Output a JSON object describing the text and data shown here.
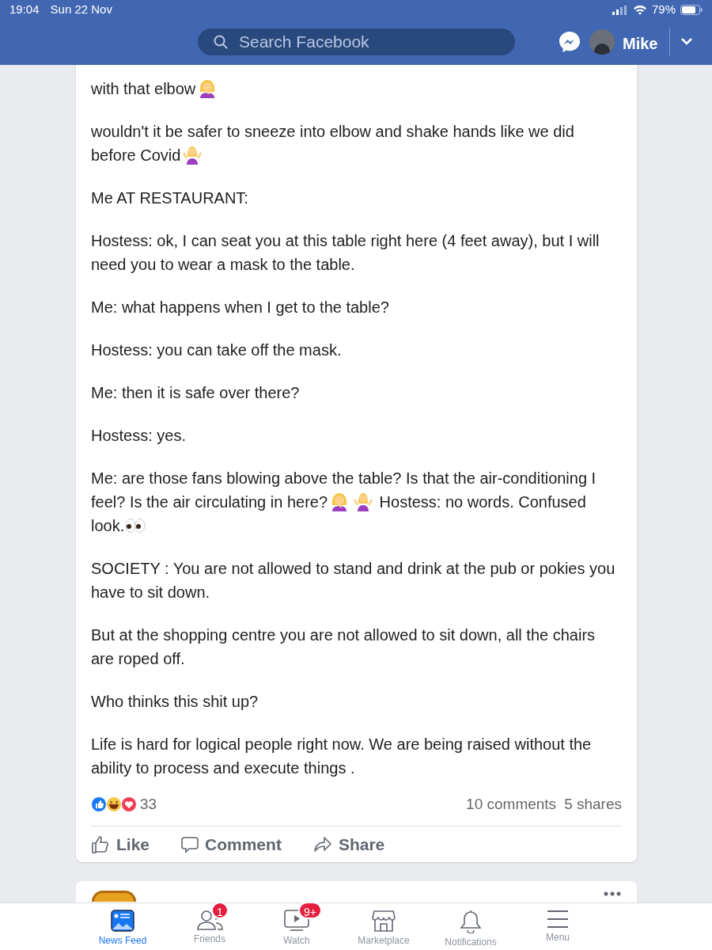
{
  "status_bar": {
    "time": "19:04",
    "date": "Sun 22 Nov",
    "battery": "79%"
  },
  "header": {
    "search": {
      "placeholder": "Search Facebook"
    },
    "user": "Mike"
  },
  "post": {
    "paragraphs": [
      [
        {
          "kind": "text",
          "text": "with that elbow"
        },
        {
          "kind": "facepalm"
        }
      ],
      [
        {
          "kind": "text",
          "text": "wouldn't it be safer to sneeze into elbow and shake hands like we did before Covid"
        },
        {
          "kind": "shrug"
        }
      ],
      [
        {
          "kind": "text",
          "text": "Me AT RESTAURANT:"
        }
      ],
      [
        {
          "kind": "text",
          "text": "Hostess: ok, I can seat you at this table right here (4 feet away), but I will need you to wear a mask to the table."
        }
      ],
      [
        {
          "kind": "text",
          "text": "Me: what happens when I get to the table?"
        }
      ],
      [
        {
          "kind": "text",
          "text": "Hostess: you can take off the mask."
        }
      ],
      [
        {
          "kind": "text",
          "text": "Me: then it is safe over there?"
        }
      ],
      [
        {
          "kind": "text",
          "text": "Hostess: yes."
        }
      ],
      [
        {
          "kind": "text",
          "text": "Me: are those fans blowing above the table? Is that the air-conditioning I feel? Is the air circulating in here?"
        },
        {
          "kind": "facepalm"
        },
        {
          "kind": "shrug"
        },
        {
          "kind": "text",
          "text": " Hostess: no words. Confused look."
        },
        {
          "kind": "eyes"
        }
      ],
      [
        {
          "kind": "text",
          "text": "SOCIETY : You are not allowed to stand and drink at the pub or pokies you have to sit down."
        }
      ],
      [
        {
          "kind": "text",
          "text": "But at the shopping centre you are not allowed to sit down, all the chairs are roped off."
        }
      ],
      [
        {
          "kind": "text",
          "text": "Who thinks this shit up?"
        }
      ],
      [
        {
          "kind": "text",
          "text": "Life is hard for logical people right now. We are being raised without the ability to process and execute things ."
        }
      ]
    ],
    "reaction_count": "33",
    "comments": "10 comments",
    "shares": "5 shares",
    "actions": [
      {
        "kind": "like",
        "label": "Like"
      },
      {
        "kind": "comment",
        "label": "Comment"
      },
      {
        "kind": "share",
        "label": "Share"
      }
    ]
  },
  "bottom_nav": [
    {
      "kind": "feed",
      "label": "News Feed",
      "selected": true
    },
    {
      "kind": "friends",
      "label": "Friends",
      "selected": false,
      "badge": "1"
    },
    {
      "kind": "watch",
      "label": "Watch",
      "selected": false,
      "badge": "9+"
    },
    {
      "kind": "marketplace",
      "label": "Marketplace",
      "selected": false
    },
    {
      "kind": "notifications",
      "label": "Notifications",
      "selected": false
    },
    {
      "kind": "menu",
      "label": "Menu",
      "selected": false
    }
  ]
}
